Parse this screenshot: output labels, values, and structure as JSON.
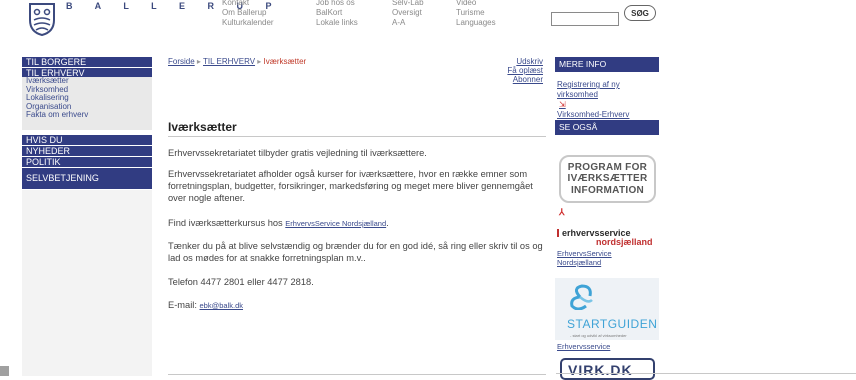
{
  "header": {
    "brand": "B A L L E R U P",
    "col1": [
      "Kontakt",
      "Om Ballerup",
      "Kulturkalender"
    ],
    "col2": [
      "Job hos os",
      "BalKort",
      "Lokale links"
    ],
    "col3": [
      "Selv-Lab",
      "Oversigt",
      "A-A"
    ],
    "col4": [
      "Video",
      "Turisme",
      "Languages"
    ],
    "search_button": "SØG",
    "search_value": ""
  },
  "nav": {
    "til_borgere": "TIL BORGERE",
    "til_erhverv": "TIL ERHVERV",
    "sub": [
      "Iværksætter",
      "Virksomhed",
      "Lokalisering",
      "Organisation",
      "Fakta om erhverv"
    ],
    "hvis_du": "HVIS DU",
    "nyheder": "NYHEDER",
    "politik": "POLITIK",
    "selvbetjening": "SELVBETJENING"
  },
  "breadcrumb": {
    "home": "Forside",
    "sep": "▸",
    "section": "TIL ERHVERV",
    "current": "Iværksætter"
  },
  "tools": {
    "print": "Udskriv",
    "read": "Få oplæst",
    "subscribe": "Abonner"
  },
  "main": {
    "title": "Iværksætter",
    "p1": "Erhvervssekretariatet tilbyder gratis vejledning til iværksættere.",
    "p2": "Erhvervssekretariatet afholder også kurser for iværksættere, hvor en række emner som forretningsplan, budgetter, forsikringer, markedsføring og meget mere bliver gennemgået over nogle aftener.",
    "p3_text": "Find iværksætterkursus hos ",
    "p3_link": "ErhvervsService Nordsjælland",
    "p3_end": ".",
    "p4": "Tænker du på at blive selvstændig og brænder du for en god idé, så ring eller skriv til os og lad os mødes for at snakke forretningsplan m.v..",
    "p5": "Telefon 4477 2801 eller 4477 2818.",
    "email_label": "E-mail: ",
    "email": "ebk@balk.dk"
  },
  "right": {
    "mere_info": "MERE INFO",
    "links": [
      "Registrering af ny",
      "virksomhed",
      "Virksomhed-Erhverv"
    ],
    "se_ogsaa": "SE OGSÅ",
    "program": [
      "PROGRAM FOR",
      "IVÆRKSÆTTER",
      "INFORMATION"
    ],
    "eh1": "erhvervsservice",
    "eh2": "nordsjælland",
    "eh_link1": "ErhvervsService",
    "eh_link2": "Nordsjælland",
    "start": "STARTGUIDEN",
    "start_tag": "- start og udvikl af virksomheder",
    "start_link": "Erhvervsservice",
    "virk": "VIRK.DK"
  },
  "colors": {
    "nav_blue": "#313c82",
    "link_blue": "#3a4a8c",
    "current_red": "#c03a2a"
  }
}
